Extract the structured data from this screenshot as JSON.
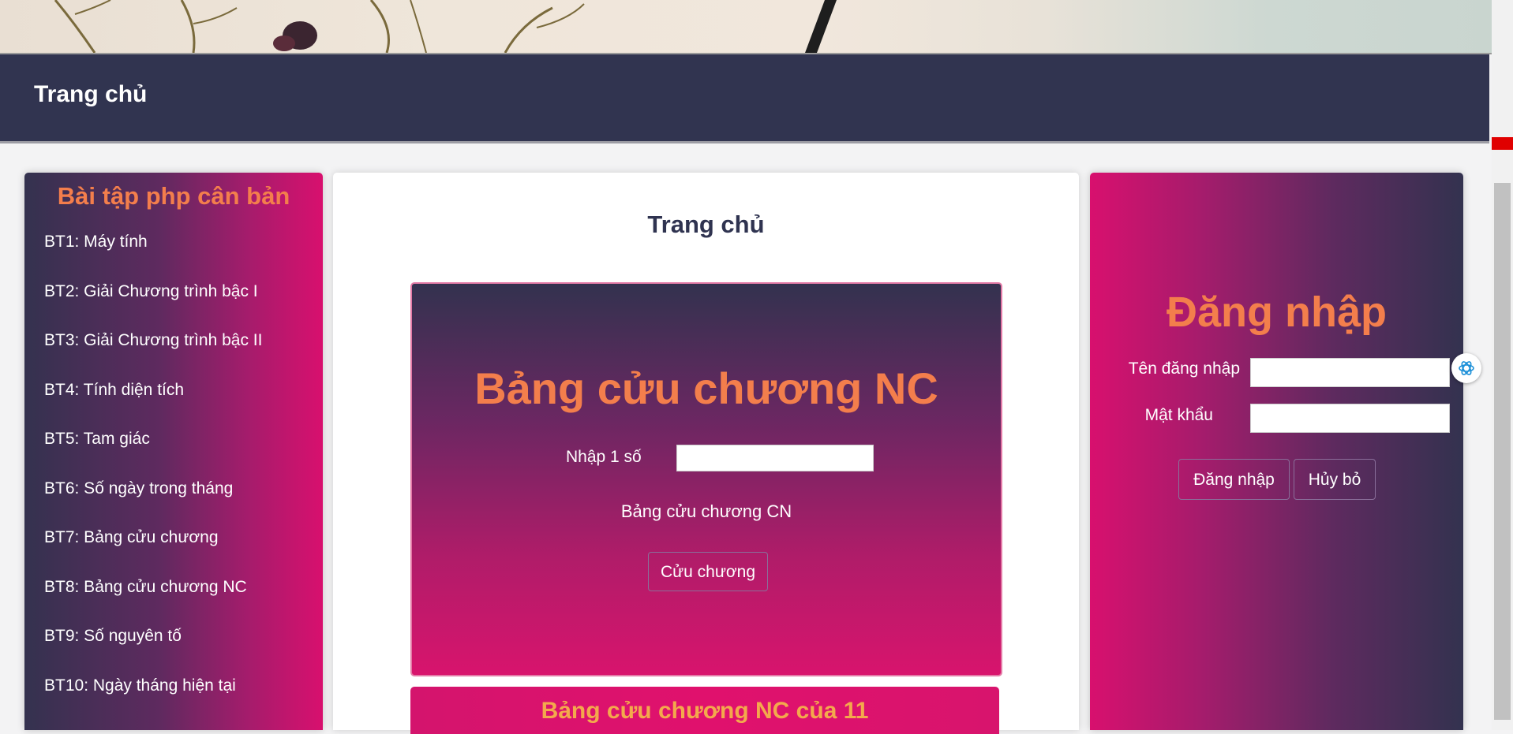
{
  "navbar": {
    "title": "Trang chủ"
  },
  "sidebar": {
    "title": "Bài tập php cân bản",
    "items": [
      {
        "label": "BT1: Máy tính"
      },
      {
        "label": "BT2: Giải Chương trình bậc I"
      },
      {
        "label": "BT3: Giải Chương trình bậc II"
      },
      {
        "label": "BT4: Tính diện tích"
      },
      {
        "label": "BT5: Tam giác"
      },
      {
        "label": "BT6: Số ngày trong tháng"
      },
      {
        "label": "BT7: Bảng cửu chương"
      },
      {
        "label": "BT8: Bảng cửu chương NC"
      },
      {
        "label": "BT9: Số nguyên tố"
      },
      {
        "label": "BT10: Ngày tháng hiện tại"
      }
    ]
  },
  "main": {
    "title": "Trang chủ",
    "calc": {
      "heading": "Bảng cửu chương NC",
      "input_label": "Nhập 1 số",
      "input_value": "",
      "subtitle": "Bảng cửu chương CN",
      "button_label": "Cửu chương"
    },
    "result": {
      "title": "Bảng cửu chương NC của 11"
    }
  },
  "login": {
    "title": "Đăng nhập",
    "username_label": "Tên đăng nhập",
    "username_value": "",
    "password_label": "Mật khẩu",
    "password_value": "",
    "submit_label": "Đăng nhập",
    "cancel_label": "Hủy bỏ"
  },
  "icons": {
    "assistant": "openai-assistant-icon"
  },
  "colors": {
    "navbar": "#313450",
    "accent_orange": "#f37e4c",
    "accent_pink": "#d8106e",
    "dark_purple": "#33324f"
  }
}
